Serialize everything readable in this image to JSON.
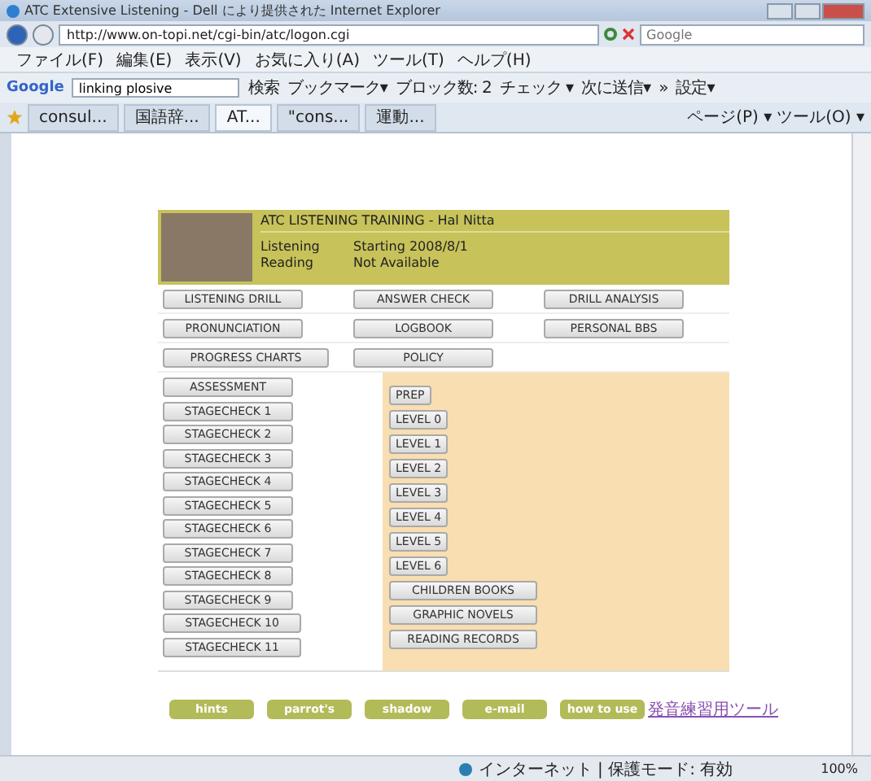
{
  "window": {
    "title": "ATC Extensive Listening - Dell により提供された Internet Explorer"
  },
  "address_bar": {
    "url": "http://www.on-topi.net/cgi-bin/atc/logon.cgi"
  },
  "search": {
    "placeholder": "Google"
  },
  "menu": [
    "ファイル(F)",
    "編集(E)",
    "表示(V)",
    "お気に入り(A)",
    "ツール(T)",
    "ヘルプ(H)"
  ],
  "google_toolbar": {
    "logo": "Google",
    "query": "linking plosive",
    "items": [
      "検索",
      "ブックマーク▾",
      "ブロック数: 2",
      "チェック ▾",
      "次に送信▾",
      "»",
      "設定▾"
    ]
  },
  "tabs": [
    {
      "label": "consul...",
      "selected": false
    },
    {
      "label": "国語辞...",
      "selected": false
    },
    {
      "label": "AT...",
      "selected": true
    },
    {
      "label": "\"cons...",
      "selected": false
    },
    {
      "label": "運動...",
      "selected": false
    }
  ],
  "command_bar": [
    "ページ(P) ▾",
    "ツール(O) ▾"
  ],
  "page": {
    "header": {
      "title": "ATC LISTENING TRAINING - Hal Nitta",
      "rows": [
        {
          "label": "Listening",
          "value": "Starting 2008/8/1"
        },
        {
          "label": "Reading",
          "value": "Not Available"
        }
      ]
    },
    "nav_rows": [
      [
        "LISTENING DRILL",
        "ANSWER CHECK",
        "DRILL ANALYSIS"
      ],
      [
        "PRONUNCIATION",
        "LOGBOOK",
        "PERSONAL BBS"
      ],
      [
        "PROGRESS CHARTS",
        "POLICY"
      ]
    ],
    "checks": [
      "ASSESSMENT",
      "STAGECHECK 1",
      "STAGECHECK 2",
      "STAGECHECK 3",
      "STAGECHECK 4",
      "STAGECHECK 5",
      "STAGECHECK 6",
      "STAGECHECK 7",
      "STAGECHECK 8",
      "STAGECHECK 9",
      "STAGECHECK 10",
      "STAGECHECK 11"
    ],
    "levels": [
      {
        "label": "PREP",
        "kind": "small"
      },
      {
        "label": "LEVEL 0",
        "kind": "small"
      },
      {
        "label": "LEVEL 1",
        "kind": "small"
      },
      {
        "label": "LEVEL 2",
        "kind": "small"
      },
      {
        "label": "LEVEL 3",
        "kind": "small"
      },
      {
        "label": "LEVEL 4",
        "kind": "small"
      },
      {
        "label": "LEVEL 5",
        "kind": "small"
      },
      {
        "label": "LEVEL 6",
        "kind": "small"
      },
      {
        "label": "CHILDREN BOOKS",
        "kind": "wide"
      },
      {
        "label": "GRAPHIC NOVELS",
        "kind": "wide"
      },
      {
        "label": "READING RECORDS",
        "kind": "wide"
      }
    ],
    "footer_buttons": [
      "hints",
      "parrot's",
      "shadow",
      "e-mail",
      "how to use"
    ],
    "footer_link": "発音練習用ツール"
  },
  "status_bar": {
    "zone": "インターネット | 保護モード: 有効",
    "zoom": "100%"
  }
}
